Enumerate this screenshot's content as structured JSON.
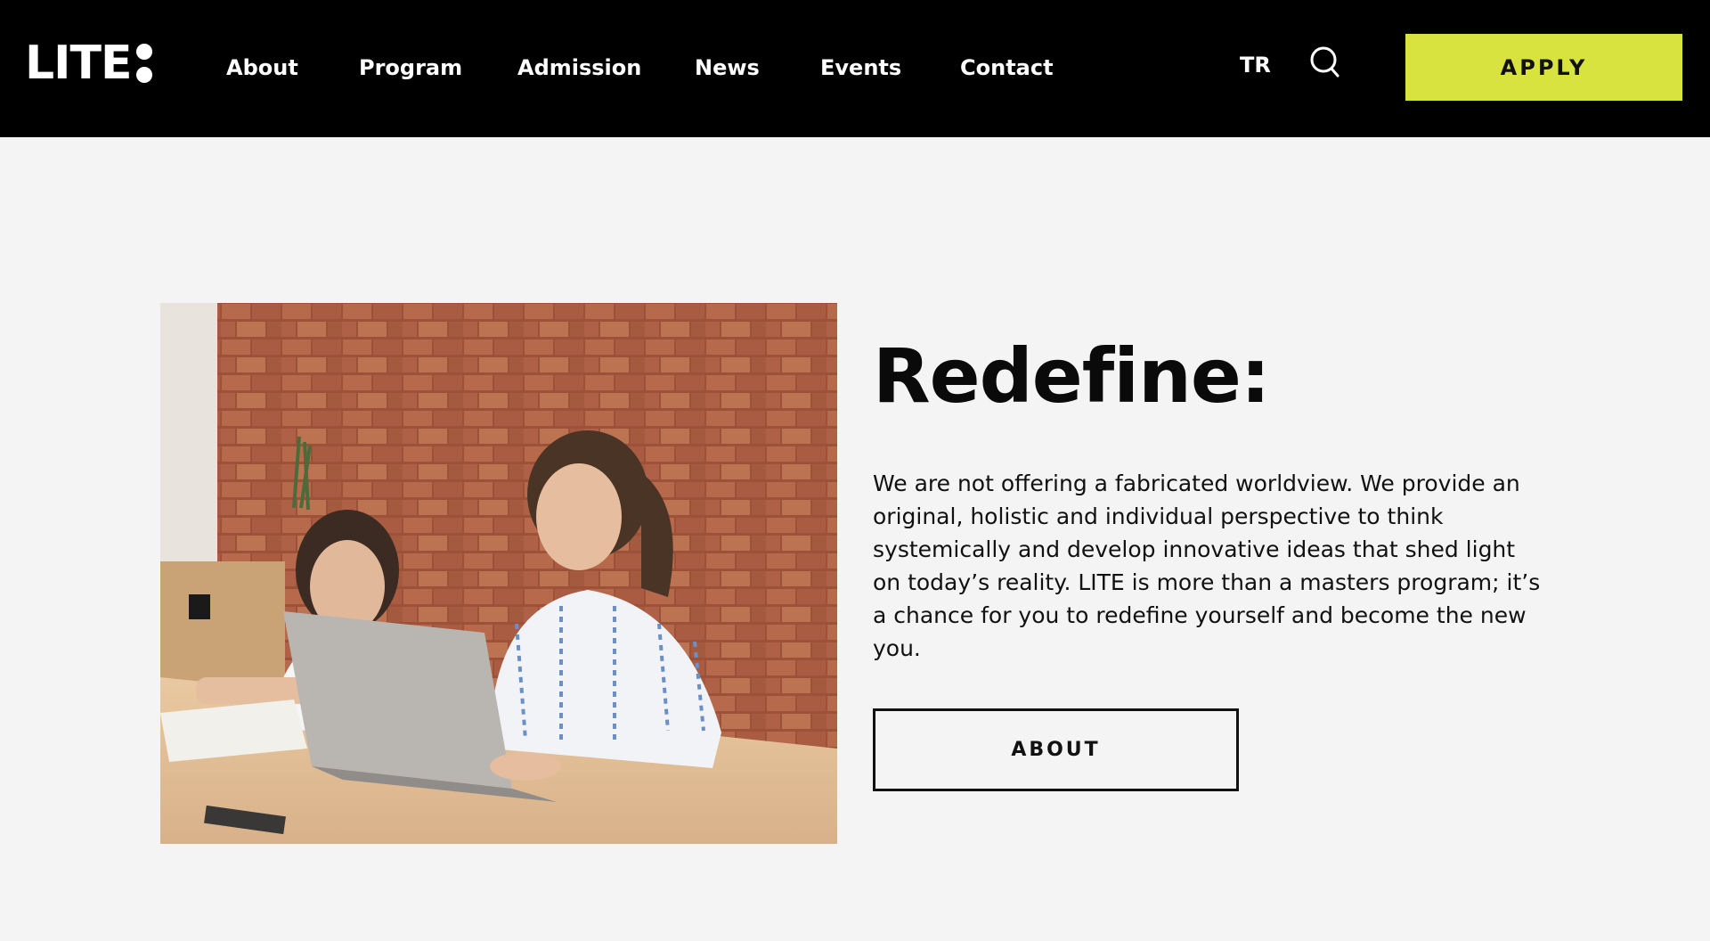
{
  "header": {
    "logo_text": "LITE",
    "nav": [
      "About",
      "Program",
      "Admission",
      "News",
      "Events",
      "Contact"
    ],
    "lang": "TR",
    "search_icon": "search-icon",
    "apply_label": "APPLY",
    "apply_color": "#d9e33f"
  },
  "main": {
    "title": "Redefine:",
    "body": "We are not offering a fabricated worldview. We provide an original, holistic and individual perspective to think systemically and develop innovative ideas that shed light on today’s reality. LITE is more than a masters program; it’s a chance for you to redefine yourself and become the new you.",
    "about_label": "ABOUT"
  }
}
